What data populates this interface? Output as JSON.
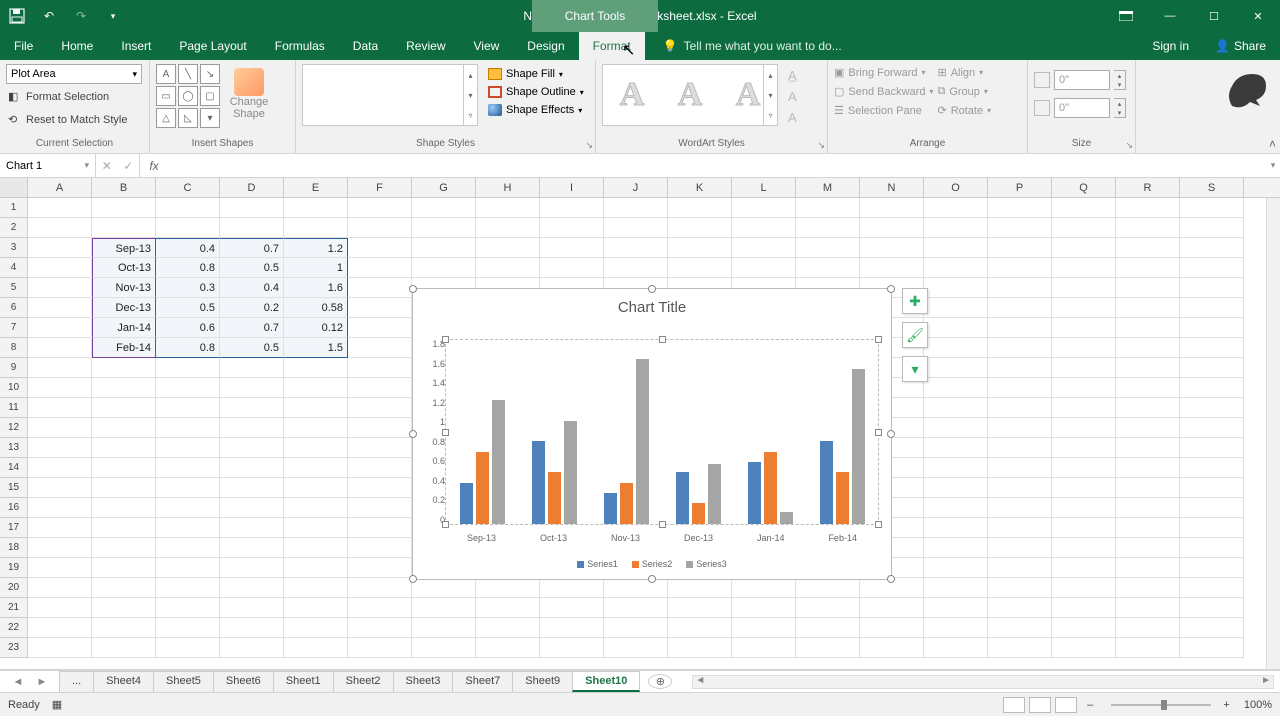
{
  "title": "New Microsoft Excel Worksheet.xlsx - Excel",
  "chart_tools_label": "Chart Tools",
  "tabs": [
    "File",
    "Home",
    "Insert",
    "Page Layout",
    "Formulas",
    "Data",
    "Review",
    "View",
    "Design",
    "Format"
  ],
  "active_tab": "Format",
  "tellme": "Tell me what you want to do...",
  "signin": "Sign in",
  "share": "Share",
  "ribbon": {
    "selection": {
      "combo": "Plot Area",
      "format_sel": "Format Selection",
      "reset": "Reset to Match Style",
      "group": "Current Selection"
    },
    "insert_shapes": {
      "change_shape": "Change Shape",
      "group": "Insert Shapes"
    },
    "shape_styles": {
      "fill": "Shape Fill",
      "outline": "Shape Outline",
      "effects": "Shape Effects",
      "group": "Shape Styles"
    },
    "wordart": {
      "group": "WordArt Styles"
    },
    "arrange": {
      "bring_forward": "Bring Forward",
      "send_backward": "Send Backward",
      "selection_pane": "Selection Pane",
      "align": "Align",
      "group_cmd": "Group",
      "rotate": "Rotate",
      "group": "Arrange"
    },
    "size": {
      "h": "0\"",
      "w": "0\"",
      "group": "Size"
    }
  },
  "namebox": "Chart 1",
  "columns": [
    "A",
    "B",
    "C",
    "D",
    "E",
    "F",
    "G",
    "H",
    "I",
    "J",
    "K",
    "L",
    "M",
    "N",
    "O",
    "P",
    "Q",
    "R",
    "S"
  ],
  "data_rows": [
    {
      "rn": 3,
      "b": "Sep-13",
      "c": "0.4",
      "d": "0.7",
      "e": "1.2"
    },
    {
      "rn": 4,
      "b": "Oct-13",
      "c": "0.8",
      "d": "0.5",
      "e": "1"
    },
    {
      "rn": 5,
      "b": "Nov-13",
      "c": "0.3",
      "d": "0.4",
      "e": "1.6"
    },
    {
      "rn": 6,
      "b": "Dec-13",
      "c": "0.5",
      "d": "0.2",
      "e": "0.58"
    },
    {
      "rn": 7,
      "b": "Jan-14",
      "c": "0.6",
      "d": "0.7",
      "e": "0.12"
    },
    {
      "rn": 8,
      "b": "Feb-14",
      "c": "0.8",
      "d": "0.5",
      "e": "1.5"
    }
  ],
  "chart": {
    "title": "Chart Title",
    "y_ticks": [
      "1.8",
      "1.6",
      "1.4",
      "1.2",
      "1",
      "0.8",
      "0.6",
      "0.4",
      "0.2",
      "0"
    ],
    "x_labels": [
      "Sep-13",
      "Oct-13",
      "Nov-13",
      "Dec-13",
      "Jan-14",
      "Feb-14"
    ],
    "legend": [
      "Series1",
      "Series2",
      "Series3"
    ]
  },
  "chart_data": {
    "type": "bar",
    "title": "Chart Title",
    "categories": [
      "Sep-13",
      "Oct-13",
      "Nov-13",
      "Dec-13",
      "Jan-14",
      "Feb-14"
    ],
    "series": [
      {
        "name": "Series1",
        "values": [
          0.4,
          0.8,
          0.3,
          0.5,
          0.6,
          0.8
        ]
      },
      {
        "name": "Series2",
        "values": [
          0.7,
          0.5,
          0.4,
          0.2,
          0.7,
          0.5
        ]
      },
      {
        "name": "Series3",
        "values": [
          1.2,
          1.0,
          1.6,
          0.58,
          0.12,
          1.5
        ]
      }
    ],
    "ylim": [
      0,
      1.8
    ],
    "xlabel": "",
    "ylabel": ""
  },
  "sheet_tabs": [
    "...",
    "Sheet4",
    "Sheet5",
    "Sheet6",
    "Sheet1",
    "Sheet2",
    "Sheet3",
    "Sheet7",
    "Sheet9",
    "Sheet10"
  ],
  "active_sheet": "Sheet10",
  "status": {
    "ready": "Ready",
    "zoom": "100%"
  }
}
